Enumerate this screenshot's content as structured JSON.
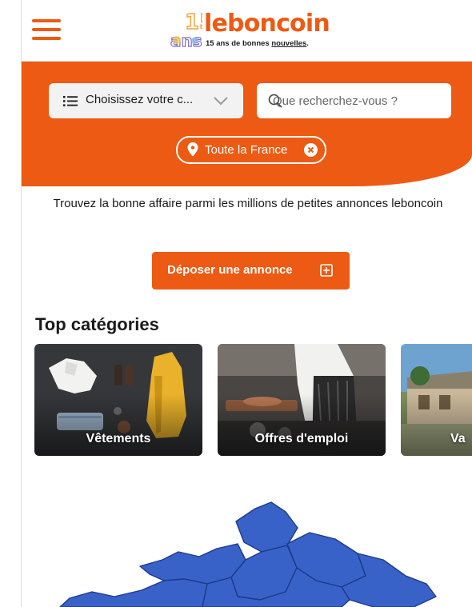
{
  "header": {
    "logo_anniversary_number": "15",
    "logo_anniversary_word": "ans",
    "logo_word": "leboncoin",
    "logo_tagline_prefix": "15 ans de bonnes ",
    "logo_tagline_underlined": "nouvelles",
    "logo_tagline_suffix": "."
  },
  "search": {
    "category_label": "Choisissez votre c...",
    "query_placeholder": "Que recherchez-vous ?",
    "location_label": "Toute la France"
  },
  "main": {
    "tagline": "Trouvez la bonne affaire parmi les millions de petites annonces leboncoin",
    "post_ad_label": "Déposer une annonce",
    "top_categories_title": "Top catégories",
    "categories": [
      {
        "label": "Vêtements"
      },
      {
        "label": "Offres d'emploi"
      },
      {
        "label": "Va"
      }
    ]
  },
  "icons": {
    "menu": "hamburger-menu-icon",
    "list": "list-icon",
    "chevron": "chevron-down-icon",
    "search": "search-icon",
    "pin": "location-pin-icon",
    "clear": "clear-icon",
    "plus": "plus-box-icon"
  },
  "colors": {
    "brand_orange": "#ec5a13",
    "map_blue": "#3862c8",
    "white": "#ffffff"
  }
}
